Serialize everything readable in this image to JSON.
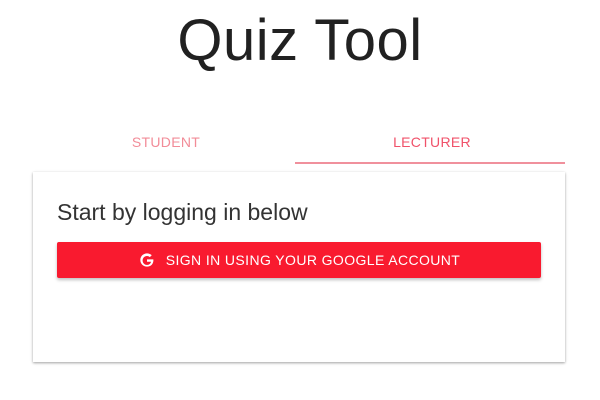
{
  "app": {
    "title": "Quiz Tool"
  },
  "tabs": [
    {
      "label": "STUDENT",
      "active": false
    },
    {
      "label": "LECTURER",
      "active": true
    }
  ],
  "login_card": {
    "heading": "Start by logging in below",
    "button_label": "SIGN IN USING YOUR GOOGLE ACCOUNT",
    "button_icon": "google-icon"
  },
  "colors": {
    "accent": "#f91a2f",
    "tab_active": "#f0526a",
    "tab_inactive": "#f28c98",
    "indicator": "#f0909c",
    "title_text": "#212121"
  }
}
